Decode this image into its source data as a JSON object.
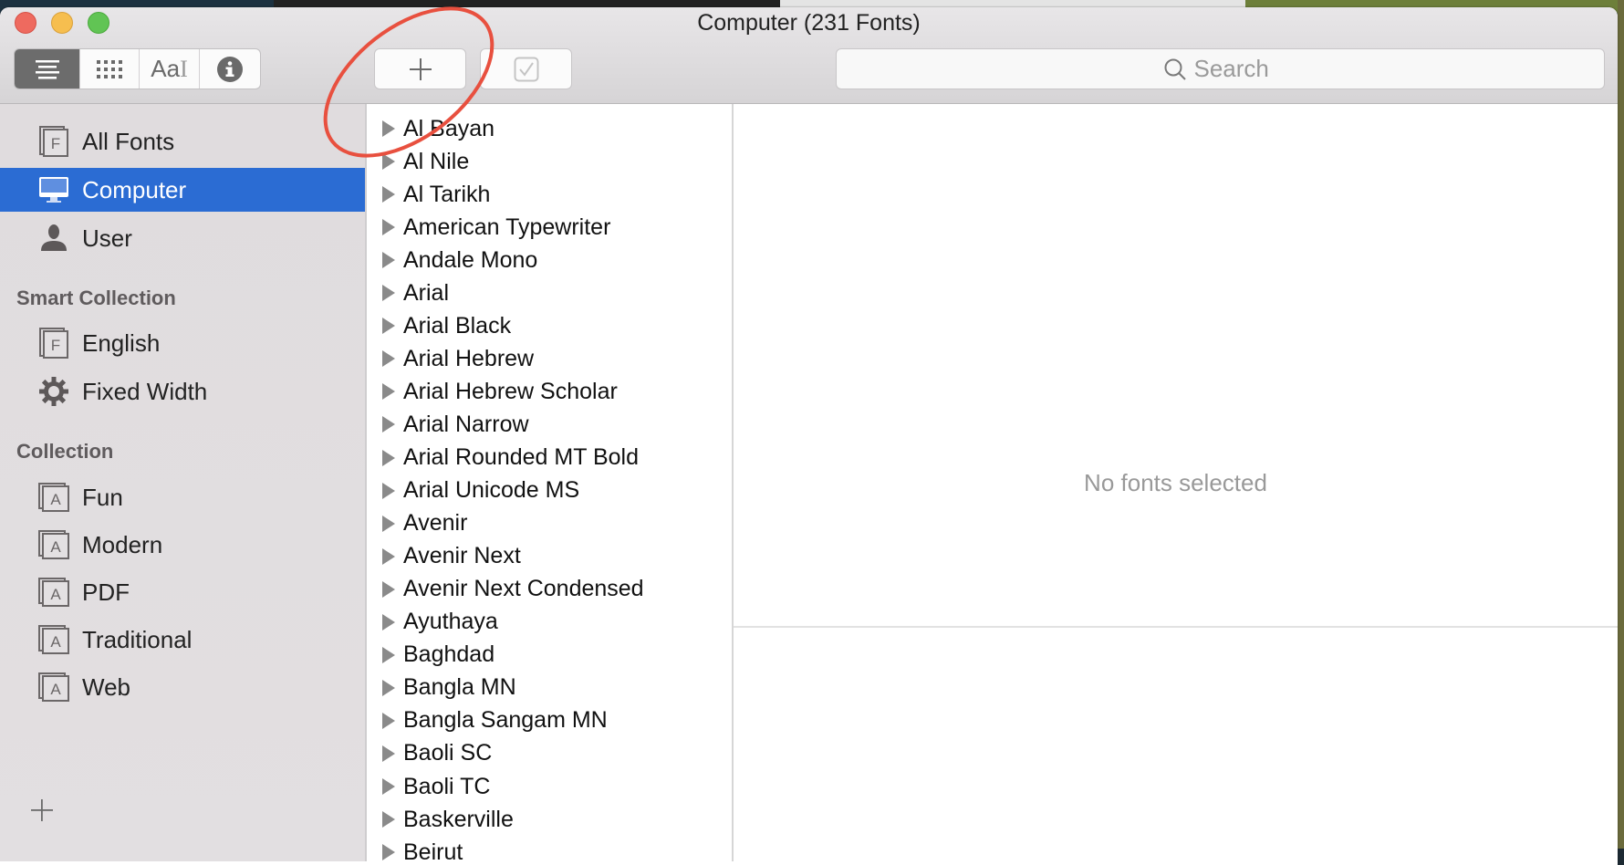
{
  "window": {
    "title": "Computer (231 Fonts)"
  },
  "toolbar": {
    "view_modes": [
      {
        "name": "list-view",
        "icon": "list-icon",
        "selected": true
      },
      {
        "name": "grid-view",
        "icon": "grid-icon",
        "selected": false
      },
      {
        "name": "sample-view",
        "icon": "sample-text-icon",
        "label": "Aa",
        "selected": false
      },
      {
        "name": "info-view",
        "icon": "info-icon",
        "selected": false
      }
    ],
    "add_button": {
      "icon": "plus-icon"
    },
    "validate_button": {
      "icon": "checkbox-icon",
      "enabled": false
    },
    "search": {
      "placeholder": "Search",
      "value": ""
    }
  },
  "sidebar": {
    "library": [
      {
        "label": "All Fonts",
        "icon": "font-book-icon",
        "selected": false
      },
      {
        "label": "Computer",
        "icon": "computer-icon",
        "selected": true
      },
      {
        "label": "User",
        "icon": "user-icon",
        "selected": false
      }
    ],
    "smart_collection_header": "Smart Collection",
    "smart_collections": [
      {
        "label": "English",
        "icon": "font-book-icon"
      },
      {
        "label": "Fixed Width",
        "icon": "gear-icon"
      }
    ],
    "collection_header": "Collection",
    "collections": [
      {
        "label": "Fun",
        "icon": "collection-icon"
      },
      {
        "label": "Modern",
        "icon": "collection-icon"
      },
      {
        "label": "PDF",
        "icon": "collection-icon"
      },
      {
        "label": "Traditional",
        "icon": "collection-icon"
      },
      {
        "label": "Web",
        "icon": "collection-icon"
      }
    ],
    "add_collection": {
      "icon": "plus-icon"
    }
  },
  "font_list": [
    "Al Bayan",
    "Al Nile",
    "Al Tarikh",
    "American Typewriter",
    "Andale Mono",
    "Arial",
    "Arial Black",
    "Arial Hebrew",
    "Arial Hebrew Scholar",
    "Arial Narrow",
    "Arial Rounded MT Bold",
    "Arial Unicode MS",
    "Avenir",
    "Avenir Next",
    "Avenir Next Condensed",
    "Ayuthaya",
    "Baghdad",
    "Bangla MN",
    "Bangla Sangam MN",
    "Baoli SC",
    "Baoli TC",
    "Baskerville",
    "Beirut"
  ],
  "preview": {
    "empty_message": "No fonts selected"
  },
  "colors": {
    "selection": "#2b6cd3",
    "annotation": "#e8503f",
    "close": "#ee6a5f",
    "minimize": "#f6be4f",
    "zoom": "#61c454"
  },
  "annotation": {
    "type": "ellipse",
    "target": "add-font-button"
  }
}
